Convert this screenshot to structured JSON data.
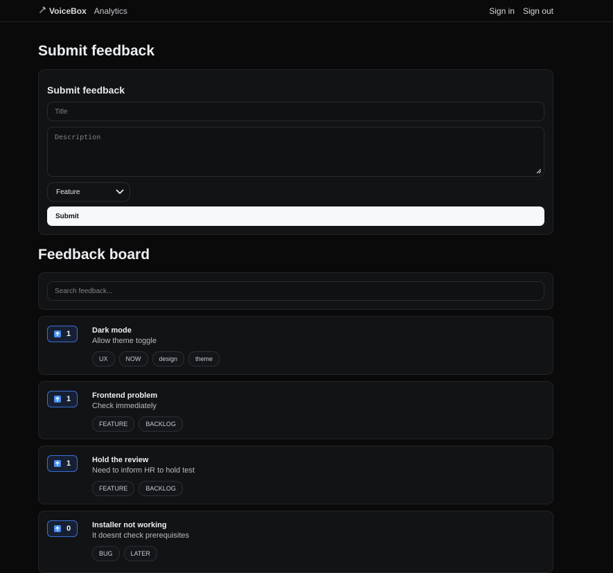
{
  "nav": {
    "brand": "VoiceBox",
    "analytics": "Analytics",
    "sign_in": "Sign in",
    "sign_out": "Sign out"
  },
  "submit_section": {
    "heading": "Submit feedback",
    "card_title": "Submit feedback",
    "title_placeholder": "Title",
    "description_placeholder": "Description",
    "category_selected": "Feature",
    "submit_label": "Submit"
  },
  "board": {
    "heading": "Feedback board",
    "search_placeholder": "Search feedback...",
    "items": [
      {
        "votes": "1",
        "title": "Dark mode",
        "description": "Allow theme toggle",
        "tags": [
          "UX",
          "NOW",
          "design",
          "theme"
        ]
      },
      {
        "votes": "1",
        "title": "Frontend problem",
        "description": "Check immediately",
        "tags": [
          "FEATURE",
          "BACKLOG"
        ]
      },
      {
        "votes": "1",
        "title": "Hold the review",
        "description": "Need to inform HR to hold test",
        "tags": [
          "FEATURE",
          "BACKLOG"
        ]
      },
      {
        "votes": "0",
        "title": "Installer not working",
        "description": "It doesnt check prerequisites",
        "tags": [
          "BUG",
          "LATER"
        ]
      }
    ]
  },
  "colors": {
    "background": "#0a0a0b",
    "card": "#121315",
    "accent": "#3b6fd6",
    "submit_button": "#f7f8fa"
  },
  "icons": {
    "logo": "hammer-icon",
    "upvote": "arrow-up-icon",
    "select": "chevron-down-icon"
  }
}
